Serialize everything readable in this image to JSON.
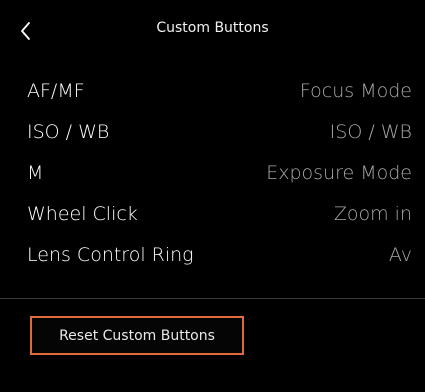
{
  "header": {
    "title": "Custom Buttons",
    "back_icon": "chevron-left-icon"
  },
  "settings": [
    {
      "label": "AF/MF",
      "value": "Focus Mode"
    },
    {
      "label": "ISO / WB",
      "value": "ISO / WB"
    },
    {
      "label": "M",
      "value": "Exposure Mode"
    },
    {
      "label": "Wheel Click",
      "value": "Zoom in"
    },
    {
      "label": "Lens Control Ring",
      "value": "Av"
    }
  ],
  "actions": {
    "reset_label": "Reset Custom Buttons"
  },
  "colors": {
    "background": "#000000",
    "primary_text": "#ffffff",
    "secondary_text": "#a9a9a9",
    "accent": "#e06b3a",
    "divider": "#3a3a3a"
  }
}
